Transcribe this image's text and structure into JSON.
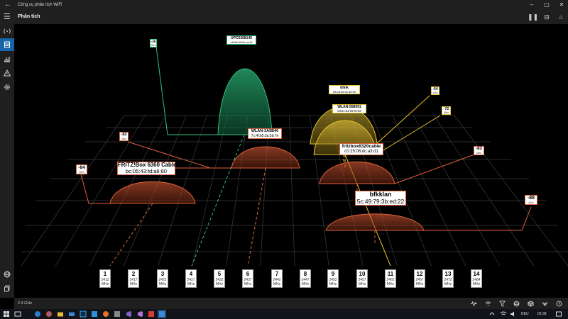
{
  "window": {
    "title": "Công cụ phân tích WiFi"
  },
  "header": {
    "page_title": "Phân tích"
  },
  "colors": {
    "green": "#2ec27e",
    "yellow": "#e6c229",
    "orange": "#e0603a",
    "accent": "#1565a8"
  },
  "channels": [
    {
      "ch": "1",
      "freq": "2412",
      "unit": "MHz"
    },
    {
      "ch": "2",
      "freq": "2417",
      "unit": "MHz"
    },
    {
      "ch": "3",
      "freq": "2422",
      "unit": "MHz"
    },
    {
      "ch": "4",
      "freq": "2427",
      "unit": "MHz"
    },
    {
      "ch": "5",
      "freq": "2432",
      "unit": "MHz"
    },
    {
      "ch": "6",
      "freq": "2437",
      "unit": "MHz"
    },
    {
      "ch": "7",
      "freq": "2442",
      "unit": "MHz"
    },
    {
      "ch": "8",
      "freq": "2447",
      "unit": "MHz"
    },
    {
      "ch": "9",
      "freq": "2452",
      "unit": "MHz"
    },
    {
      "ch": "10",
      "freq": "2457",
      "unit": "MHz"
    },
    {
      "ch": "11",
      "freq": "2462",
      "unit": "MHz"
    },
    {
      "ch": "12",
      "freq": "2467",
      "unit": "MHz"
    },
    {
      "ch": "13",
      "freq": "2472",
      "unit": "MHz"
    },
    {
      "ch": "14",
      "freq": "2484",
      "unit": "MHz"
    }
  ],
  "networks": [
    {
      "name": "UPC5268145",
      "mac": "c6:66:50:6e:cb:0f",
      "dbm": "-38",
      "unit": "dBm",
      "color": "green"
    },
    {
      "name": "dlink",
      "mac": "b8:a3:86:3c:a5:50",
      "dbm": "-64",
      "unit": "dBm",
      "color": "yellow"
    },
    {
      "name": "WLAN-558091",
      "mac": "d4:21:22:e0:0c:63",
      "dbm": "-72",
      "unit": "dBm",
      "color": "yellow"
    },
    {
      "name": "WLAN-3A5B40",
      "mac": "7c:4f:b5:3a:5b:7e",
      "dbm": "-82",
      "unit": "dBm",
      "color": "orange"
    },
    {
      "name": "fritzbox6320cable",
      "mac": "c0:25:06:dc:a3:d1",
      "dbm": "-83",
      "unit": "dBm",
      "color": "orange"
    },
    {
      "name": "FRITZ!Box 6360 Cable",
      "mac": "bc:05:43:fd:a6:80",
      "dbm": "-84",
      "unit": "dBm",
      "color": "orange"
    },
    {
      "name": "bfkklan",
      "mac": "5c:49:79:3b:ed:22",
      "dbm": "-88",
      "unit": "dBm",
      "color": "orange"
    }
  ],
  "statusbar": {
    "band": "2.4 GHz"
  },
  "taskbar": {
    "lang": "DEU",
    "time": "05:38"
  }
}
